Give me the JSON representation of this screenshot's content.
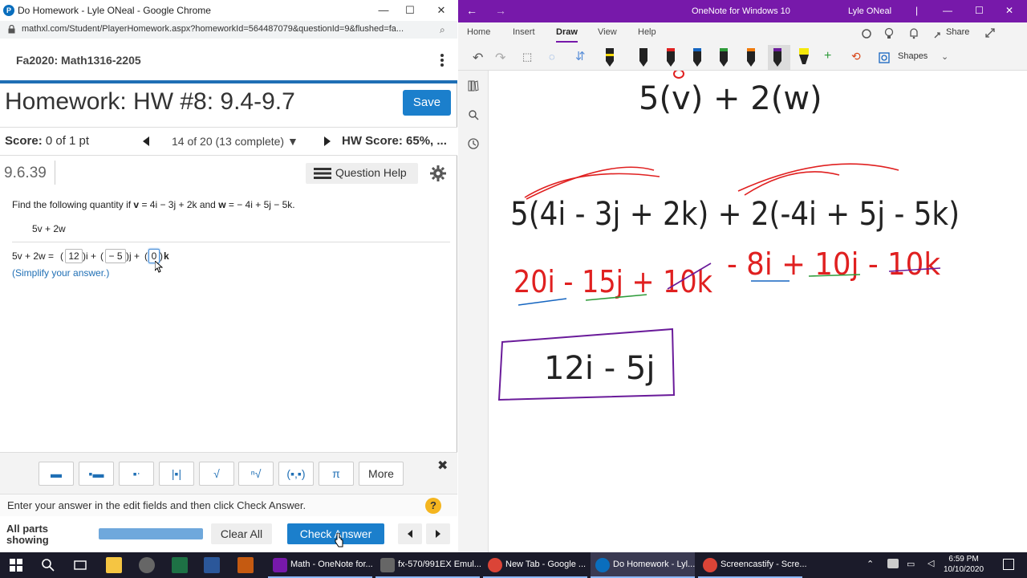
{
  "chrome": {
    "title": "Do Homework - Lyle ONeal - Google Chrome",
    "url": "mathxl.com/Student/PlayerHomework.aspx?homeworkId=564487079&questionId=9&flushed=fa...",
    "course": "Fa2020: Math1316-2205",
    "hw_title": "Homework: HW #8: 9.4-9.7",
    "save_label": "Save",
    "score_label": "Score:",
    "score_value": "0 of 1 pt",
    "question_progress": "14 of 20 (13 complete)",
    "hw_score": "HW Score: 65%, ...",
    "question_id": "9.6.39",
    "question_help": "Question Help",
    "problem_text_1": "Find the following quantity if ",
    "problem_v": "v",
    "problem_text_2": " = 4i − 3j + 2k and ",
    "problem_w": "w",
    "problem_text_3": " = − 4i + 5j − 5k.",
    "expression": "5v + 2w",
    "answer_prefix": "5v + 2w = ",
    "answer_i": "12",
    "answer_j": "− 5",
    "answer_k": "0",
    "answer_i_suffix": "i + ",
    "answer_j_suffix": "j + ",
    "answer_k_suffix": "k",
    "simplify": "(Simplify your answer.)",
    "more_label": "More",
    "pi_label": "π",
    "instructions": "Enter your answer in the edit fields and then click Check Answer.",
    "all_parts_1": "All parts",
    "all_parts_2": "showing",
    "clear_all": "Clear All",
    "check_answer": "Check Answer",
    "accent": "#1b7fcc"
  },
  "onenote": {
    "title": "OneNote for Windows 10",
    "user": "Lyle ONeal",
    "tabs": [
      "Home",
      "Insert",
      "Draw",
      "View",
      "Help"
    ],
    "active_tab": "Draw",
    "share": "Share",
    "shapes": "Shapes",
    "accent": "#7719aa",
    "ink": {
      "line1": "5(v) + 2(w)",
      "line2": "5(4i - 3j + 2k) + 2(-4i + 5j - 5k)",
      "line3_a": "20i - 15j + 10k",
      "line3_b": "- 8i + 10j - 10k",
      "boxed": "12i - 5j"
    }
  },
  "taskbar": {
    "apps": [
      {
        "label": "Math - OneNote for...",
        "color": "#7719aa"
      },
      {
        "label": "fx-570/991EX Emul...",
        "color": "#666"
      },
      {
        "label": "New Tab - Google ...",
        "color": "#db4437"
      },
      {
        "label": "Do Homework - Lyl...",
        "color": "#0a6ebd"
      },
      {
        "label": "Screencastify - Scre...",
        "color": "#db4437"
      }
    ],
    "time": "6:59 PM",
    "date": "10/10/2020"
  }
}
